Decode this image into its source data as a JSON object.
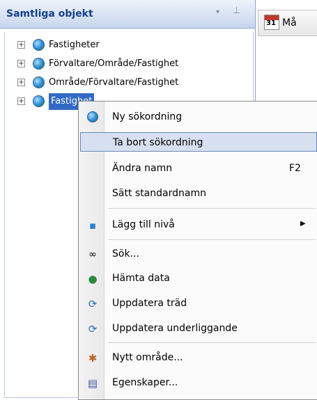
{
  "panel": {
    "title": "Samtliga objekt",
    "dropdown_icon": "▾",
    "pin_icon": "⊥"
  },
  "tree": {
    "expander": "+",
    "items": [
      {
        "label": "Fastigheter"
      },
      {
        "label": "Förvaltare/Område/Fastighet"
      },
      {
        "label": "Område/Förvaltare/Fastighet"
      },
      {
        "label": "Fastighet"
      }
    ]
  },
  "document_tab": {
    "label": "Må",
    "calendar_number": "31"
  },
  "context_menu": {
    "items": [
      {
        "label": "Ny sökordning",
        "icon": "globe-icon"
      },
      {
        "label": "Ta bort sökordning",
        "state": "highlighted"
      },
      {
        "label": "Ändra namn",
        "shortcut": "F2"
      },
      {
        "label": "Sätt standardnamn"
      },
      {
        "label": "Lägg till nivå",
        "icon": "add-level-icon",
        "submenu_arrow": "▶"
      },
      {
        "label": "Sök...",
        "icon": "binoculars-icon"
      },
      {
        "label": "Hämta data",
        "icon": "fetch-data-icon"
      },
      {
        "label": "Uppdatera träd",
        "icon": "refresh-icon"
      },
      {
        "label": "Uppdatera underliggande",
        "icon": "refresh-icon"
      },
      {
        "label": "Nytt område...",
        "icon": "new-area-icon"
      },
      {
        "label": "Egenskaper...",
        "icon": "properties-icon"
      }
    ]
  },
  "colors": {
    "header_text": "#15428b",
    "selection": "#316ac5",
    "menu_highlight": "#d6e0f1"
  }
}
